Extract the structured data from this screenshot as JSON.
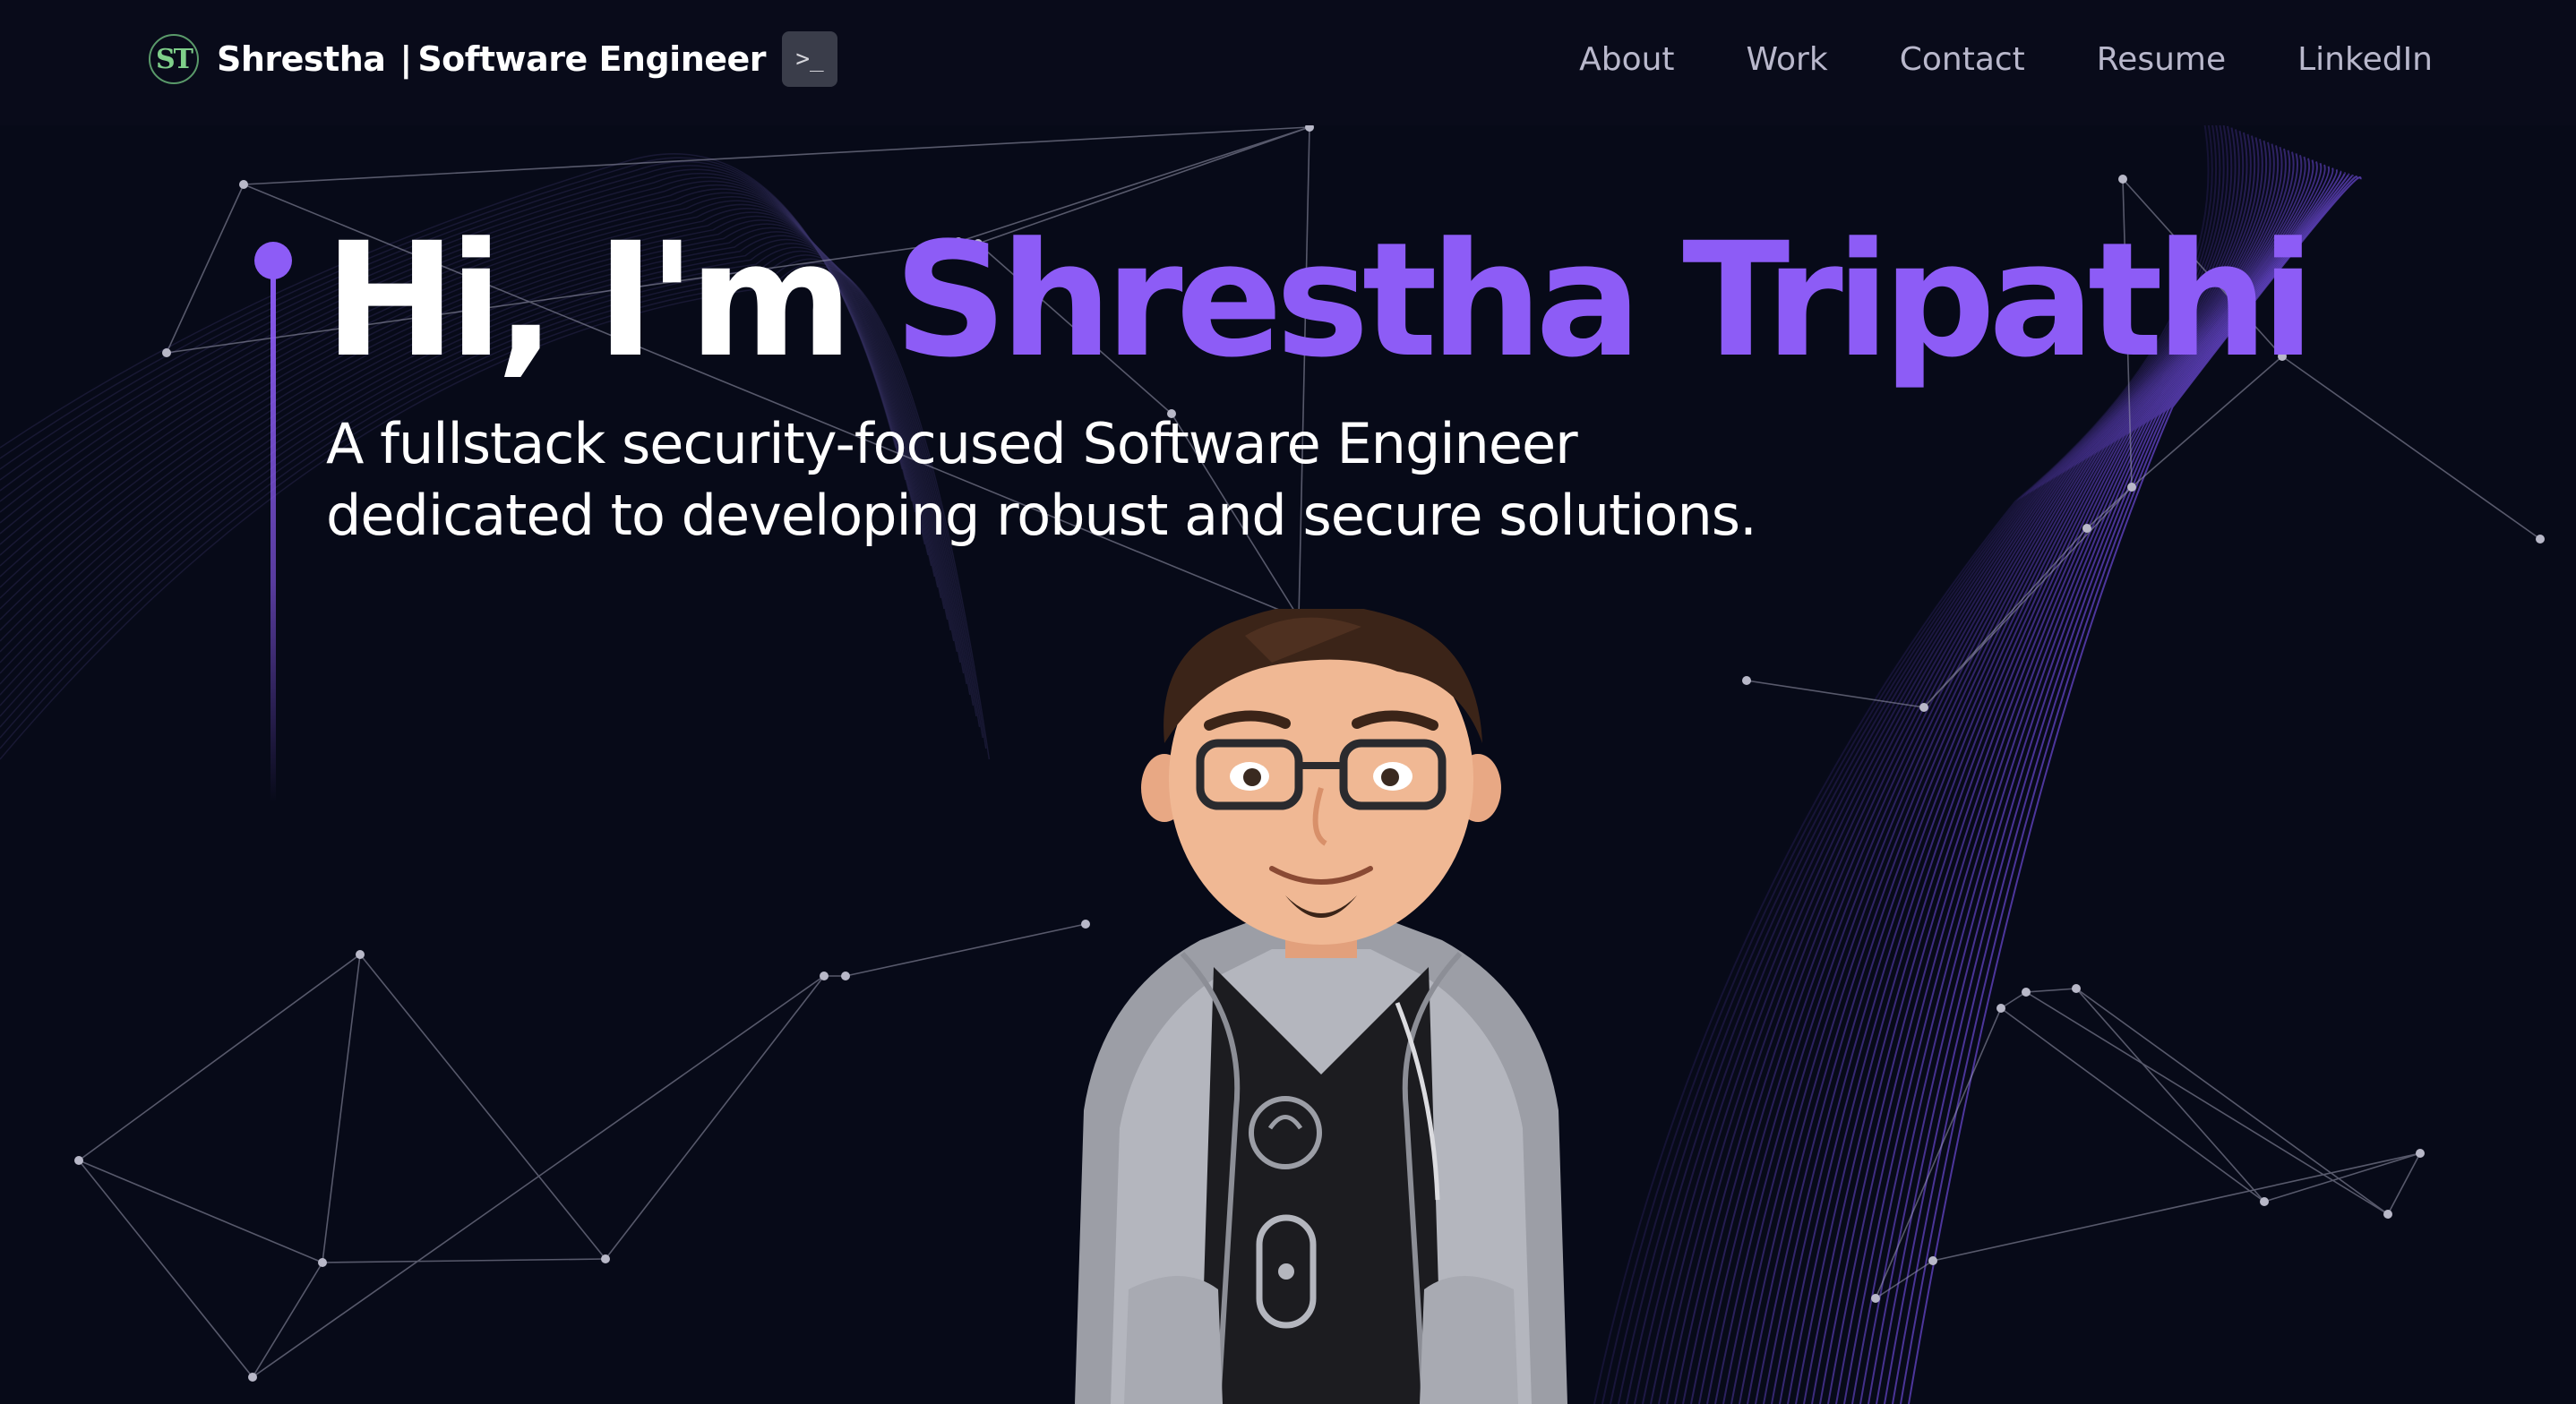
{
  "nav": {
    "logo_text": "ST",
    "brand_name": "Shrestha",
    "brand_separator": "|",
    "brand_role": "Software Engineer",
    "terminal_icon": "terminal-icon",
    "terminal_glyph": ">_",
    "links": [
      "About",
      "Work",
      "Contact",
      "Resume",
      "LinkedIn"
    ]
  },
  "hero": {
    "greeting": "Hi, I'm",
    "name": "Shrestha Tripathi",
    "tagline_line1": "A fullstack security-focused Software Engineer",
    "tagline_line2": "dedicated to developing robust and secure solutions."
  },
  "colors": {
    "background": "#070a18",
    "accent": "#8d5cf6",
    "nav_link": "#b9b8cc",
    "text": "#ffffff"
  },
  "avatar": {
    "description_icon": "avatar-illustration"
  }
}
